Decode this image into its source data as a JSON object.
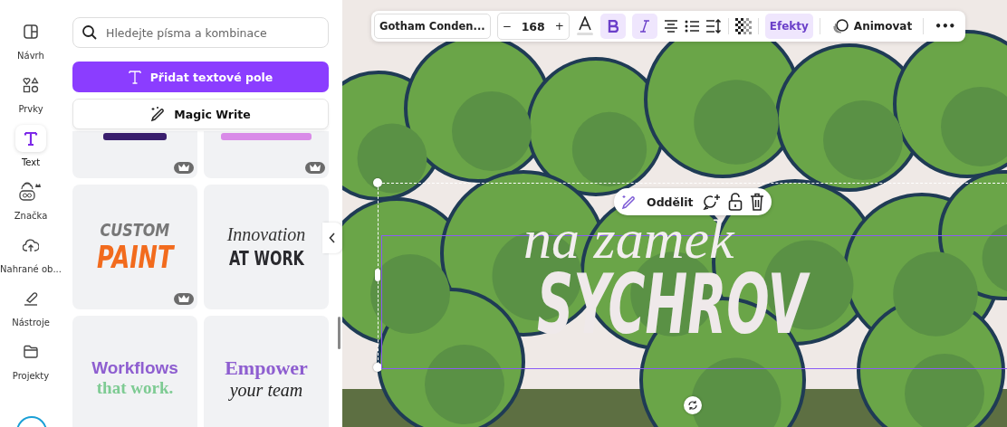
{
  "rail": [
    {
      "label": "Návrh",
      "selected": false
    },
    {
      "label": "Prvky",
      "selected": false
    },
    {
      "label": "Text",
      "selected": true
    },
    {
      "label": "Značka",
      "selected": false
    },
    {
      "label": "Nahrané ob...",
      "selected": false
    },
    {
      "label": "Nástroje",
      "selected": false
    },
    {
      "label": "Projekty",
      "selected": false
    }
  ],
  "search": {
    "placeholder": "Hledejte písma a kombinace"
  },
  "add_text_button": "Přidat textové pole",
  "magic_write_button": "Magic Write",
  "templates": [
    {
      "kind": "cut",
      "premium": true
    },
    {
      "kind": "cut",
      "premium": true
    },
    {
      "kind": "combo",
      "premium": true,
      "lines": [
        {
          "text": "CUSTOM",
          "kind": "brush-grey"
        },
        {
          "text": "PAINT",
          "kind": "brush-orange"
        }
      ]
    },
    {
      "kind": "combo",
      "premium": false,
      "lines": [
        {
          "text": "Innovation",
          "kind": "script"
        },
        {
          "text": "AT WORK",
          "kind": "condensed"
        }
      ]
    },
    {
      "kind": "combo",
      "premium": false,
      "lines": [
        {
          "text": "Workflows",
          "kind": "sans-purple"
        },
        {
          "text": "that work.",
          "kind": "serif-green"
        }
      ]
    },
    {
      "kind": "combo",
      "premium": false,
      "lines": [
        {
          "text": "Empower",
          "kind": "serif-purple"
        },
        {
          "text": "your team",
          "kind": "serif-italic"
        }
      ]
    }
  ],
  "toolbar": {
    "font": "Gotham Conden...",
    "decrease": "−",
    "size": "168",
    "increase": "+",
    "bold": true,
    "italic": true,
    "effects": "Efekty",
    "animate": "Animovat",
    "more": "•••"
  },
  "canvas": {
    "script_line": "na zamek",
    "title": "SYCHROV",
    "chip_label": "Oddělit"
  }
}
